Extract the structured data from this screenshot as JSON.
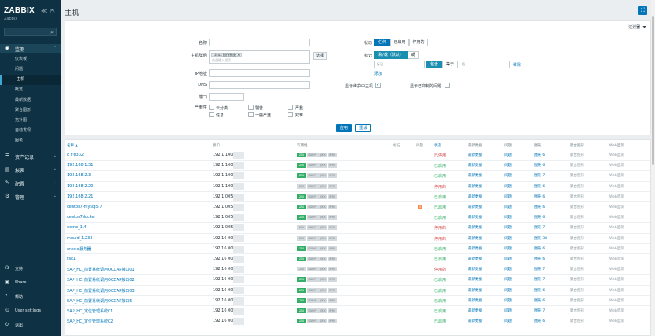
{
  "sidebar": {
    "logo": "ZABBIX",
    "logo_sub": "Zabbix",
    "collapse_icon": "≪",
    "kiosk_icon": "⇱",
    "monitoring_label": "监测",
    "sub_items": [
      "仪表板",
      "问题",
      "主机",
      "概览",
      "最新数据",
      "聚合图形",
      "拓扑图",
      "自动发现",
      "服务"
    ],
    "sections": [
      "资产记录",
      "报表",
      "配置",
      "管理"
    ],
    "bottom": [
      "支持",
      "Share",
      "帮助",
      "User settings",
      "退出"
    ]
  },
  "main": {
    "title": "主机",
    "filter": {
      "tab_label": "过滤器",
      "name_label": "名称",
      "hostgroup_label": "主机群组",
      "hostgroup_chip": "Linux 操作系统",
      "hostgroup_placeholder": "在此输入搜索",
      "select_label": "选择",
      "ip_label": "IP地址",
      "dns_label": "DNS",
      "port_label": "端口",
      "severity_label": "严重性",
      "severities": [
        "未分类",
        "信息",
        "警告",
        "一般严重",
        "严重",
        "灾难"
      ],
      "status_label": "状态",
      "status_options": [
        "任何",
        "已启用",
        "停用的"
      ],
      "tags_label": "标记",
      "tag_modes": [
        "和/或（默认）",
        "或"
      ],
      "tag_placeholder": "标记",
      "tag_op1": "包含",
      "tag_op2": "等于",
      "tag_value_placeholder": "值",
      "remove_label": "移除",
      "add_label": "添加",
      "maintenance_label": "显示维护中主机",
      "suppressed_label": "显示已抑制的问题",
      "apply_label": "应用",
      "reset_label": "重设"
    },
    "table": {
      "headers": [
        "名称 ▲",
        "接口",
        "可用性",
        "标记",
        "问题",
        "状态",
        "最新数据",
        "问题",
        "图形",
        "聚合图形",
        "Web监测"
      ],
      "rows": [
        {
          "name": "8 fre332",
          "ip": "192.1  10050",
          "zbx": true,
          "status": "已停用",
          "on": false,
          "problem": "",
          "graph": "图形 6"
        },
        {
          "name": "192.168.1.31",
          "ip": "192.1  10050",
          "zbx": true,
          "status": "已启用",
          "on": true,
          "problem": "",
          "graph": "图形 6"
        },
        {
          "name": "192.168.2.3",
          "ip": "192.1  10050",
          "zbx": true,
          "status": "已启用",
          "on": true,
          "problem": "",
          "graph": "图形 7"
        },
        {
          "name": "192.168.2.20",
          "ip": "192.1  10050",
          "zbx": false,
          "status": "停用的",
          "on": false,
          "problem": "",
          "graph": "图形 6"
        },
        {
          "name": "192.168.2.21",
          "ip": "192.1  0050",
          "zbx": true,
          "status": "已启用",
          "on": true,
          "problem": "",
          "graph": "图形 6"
        },
        {
          "name": "centos7-mysql5.7",
          "ip": "192.1  0050",
          "zbx": true,
          "status": "已启用",
          "on": true,
          "problem": "1",
          "graph": "图形 6"
        },
        {
          "name": "centos7docker",
          "ip": "192.1  0050",
          "zbx": true,
          "status": "已启用",
          "on": true,
          "problem": "",
          "graph": "图形 6"
        },
        {
          "name": "demo_1.4",
          "ip": "192.1  0050",
          "zbx": false,
          "status": "停用的",
          "on": false,
          "problem": "",
          "graph": "图形 7"
        },
        {
          "name": "mould_1.233",
          "ip": "192.16  0050",
          "zbx": false,
          "status": "停用的",
          "on": false,
          "problem": "",
          "graph": "图形 34"
        },
        {
          "name": "oracle服务器",
          "ip": "192.16  0050",
          "zbx": true,
          "status": "已启用",
          "on": true,
          "problem": "",
          "graph": "图形 6"
        },
        {
          "name": "tac1",
          "ip": "192.16  0050",
          "zbx": true,
          "status": "已启用",
          "on": true,
          "problem": "",
          "graph": "图形 6"
        },
        {
          "name": "SAP_HC_前置系统调用OCCAP接口01",
          "ip": "192.16  0050",
          "zbx": false,
          "status": "停用的",
          "on": false,
          "problem": "",
          "graph": "图形 7"
        },
        {
          "name": "SAP_HC_前置系统调用OCCAP接口02",
          "ip": "192.16  0050",
          "zbx": true,
          "status": "已启用",
          "on": true,
          "problem": "",
          "graph": "图形 7"
        },
        {
          "name": "SAP_HC_前置系统调用OCCAP接口03",
          "ip": "192.16  0050",
          "zbx": true,
          "status": "已启用",
          "on": true,
          "problem": "",
          "graph": "图形 6"
        },
        {
          "name": "SAP_HC_前置系统调用OCCAP接口5",
          "ip": "192.16  0050",
          "zbx": true,
          "status": "已启用",
          "on": true,
          "problem": "",
          "graph": "图形 6"
        },
        {
          "name": "SAP_HC_定位管理系统01",
          "ip": "192.16  0050",
          "zbx": true,
          "status": "已启用",
          "on": true,
          "problem": "",
          "graph": "图形 7"
        },
        {
          "name": "SAP_HC_定位管理系统02",
          "ip": "192.16  0050",
          "zbx": true,
          "status": "已启用",
          "on": true,
          "problem": "",
          "graph": "图形 6"
        }
      ],
      "zbx_label": "ZBX",
      "other_av": [
        "SNMP",
        "JMX",
        "IPMI"
      ],
      "latest_label": "最新数据",
      "problems_link": "问题",
      "dashboards_label": "聚合图形",
      "web_label": "Web监测"
    }
  }
}
